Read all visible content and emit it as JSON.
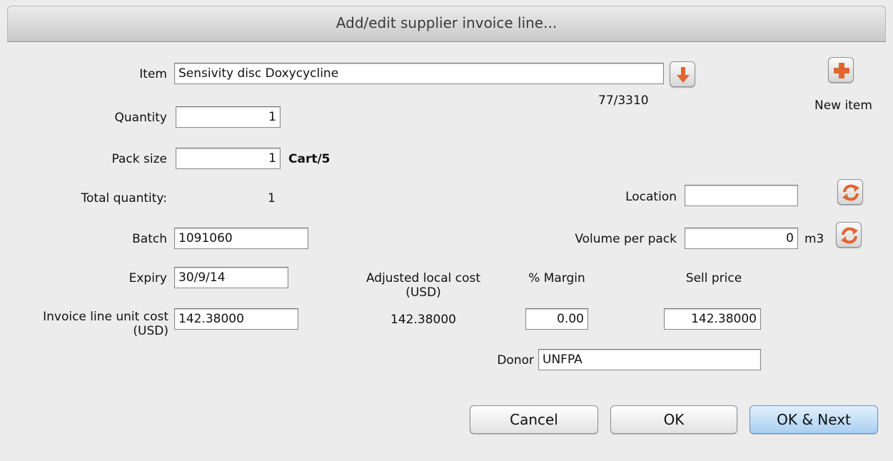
{
  "window": {
    "title": "Add/edit supplier invoice line..."
  },
  "item": {
    "label": "Item",
    "value": "Sensivity disc Doxycycline",
    "counter": "77/3310"
  },
  "new_item": {
    "label": "New item"
  },
  "quantity": {
    "label": "Quantity",
    "value": "1"
  },
  "pack_size": {
    "label": "Pack size",
    "value": "1",
    "unit": "Cart/5"
  },
  "total_quantity": {
    "label": "Total quantity:",
    "value": "1"
  },
  "location": {
    "label": "Location",
    "value": ""
  },
  "batch": {
    "label": "Batch",
    "value": "1091060"
  },
  "volume": {
    "label": "Volume per pack",
    "value": "0",
    "unit": "m3"
  },
  "expiry": {
    "label": "Expiry",
    "value": "30/9/14"
  },
  "adjusted_cost": {
    "label_line1": "Adjusted local cost",
    "label_line2": "(USD)",
    "value": "142.38000"
  },
  "margin": {
    "label": "% Margin",
    "value": "0.00"
  },
  "sell_price": {
    "label": "Sell price",
    "value": "142.38000"
  },
  "unit_cost": {
    "label_line1": "Invoice line unit cost",
    "label_line2": "(USD)",
    "value": "142.38000"
  },
  "donor": {
    "label": "Donor",
    "value": "UNFPA"
  },
  "buttons": {
    "cancel": "Cancel",
    "ok": "OK",
    "ok_next": "OK & Next"
  },
  "icons": {
    "down_arrow": "down-arrow-icon",
    "plus": "plus-icon",
    "refresh": "refresh-icon"
  },
  "colors": {
    "accent_orange": "#e2642e",
    "primary_button": "#a9cff0"
  }
}
